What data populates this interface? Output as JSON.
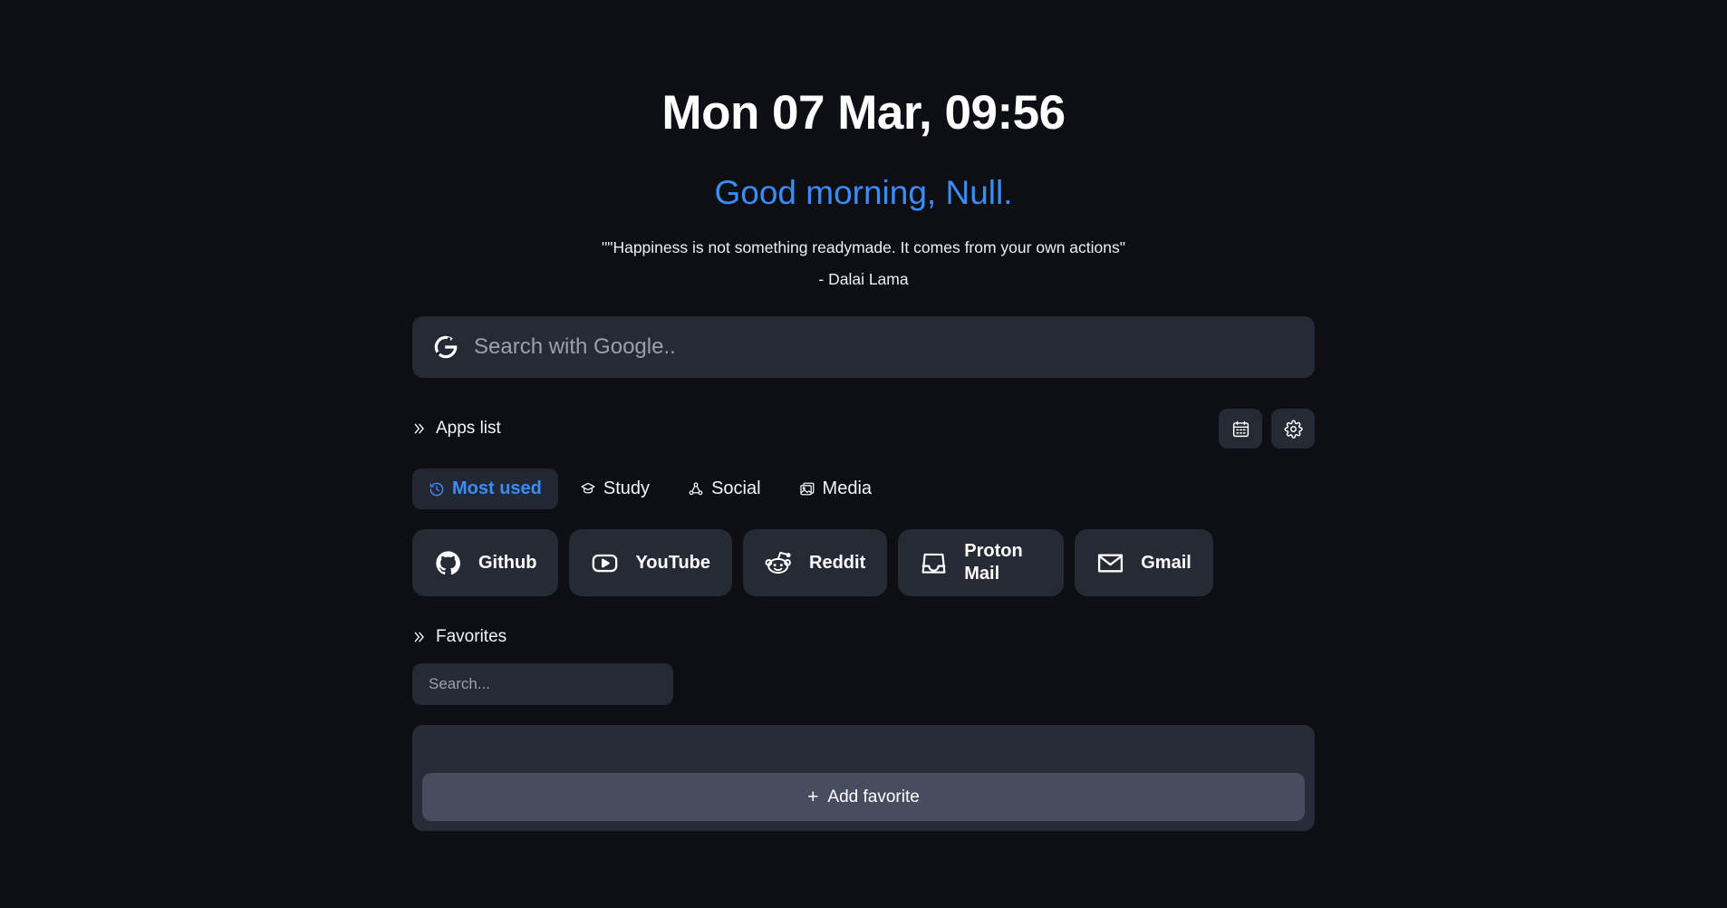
{
  "header": {
    "clock": "Mon 07 Mar, 09:56",
    "greeting": "Good morning, Null.",
    "quote": "\"\"Happiness is not something readymade. It comes from your own actions\"",
    "quote_author": "- Dalai Lama"
  },
  "search": {
    "placeholder": "Search with Google..",
    "engine_icon": "google-g-icon"
  },
  "apps_section": {
    "title": "Apps list",
    "expand_icon": "double-chevron-right-icon",
    "actions": [
      {
        "name": "calendar",
        "icon": "calendar-icon"
      },
      {
        "name": "settings",
        "icon": "gear-icon"
      }
    ],
    "tabs": [
      {
        "label": "Most used",
        "icon": "clock-history-icon",
        "active": true
      },
      {
        "label": "Study",
        "icon": "graduation-cap-icon",
        "active": false
      },
      {
        "label": "Social",
        "icon": "share-nodes-icon",
        "active": false
      },
      {
        "label": "Media",
        "icon": "image-icon",
        "active": false
      }
    ],
    "apps": [
      {
        "label": "Github",
        "icon": "github-icon"
      },
      {
        "label": "YouTube",
        "icon": "youtube-icon"
      },
      {
        "label": "Reddit",
        "icon": "reddit-icon"
      },
      {
        "label": "Proton Mail",
        "icon": "proton-mail-icon"
      },
      {
        "label": "Gmail",
        "icon": "gmail-envelope-icon"
      }
    ]
  },
  "favorites_section": {
    "title": "Favorites",
    "expand_icon": "double-chevron-right-icon",
    "search_placeholder": "Search...",
    "add_label": "Add favorite",
    "add_icon": "plus-icon"
  },
  "colors": {
    "background": "#0d0f14",
    "surface": "#252a35",
    "panel": "#272c38",
    "button": "#474d5e",
    "accent": "#3b8cf5",
    "text": "#ffffff",
    "muted": "#9aa0ad"
  }
}
